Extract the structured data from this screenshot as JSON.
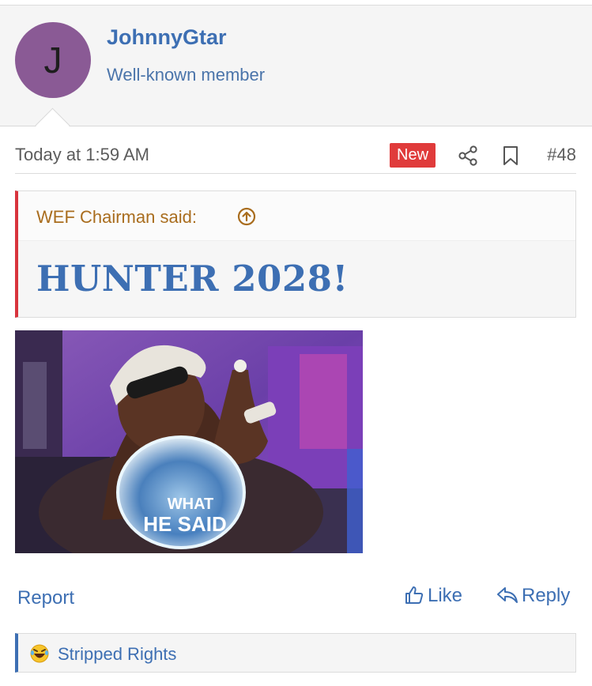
{
  "user": {
    "avatar_letter": "J",
    "name": "JohnnyGtar",
    "title": "Well-known member"
  },
  "post": {
    "timestamp": "Today at 1:59 AM",
    "new_label": "New",
    "number": "#48"
  },
  "quote": {
    "author": "WEF Chairman said:",
    "text": "HUNTER 2028!"
  },
  "gif": {
    "caption_line1": "WHAT",
    "caption_line2": "HE SAID"
  },
  "actions": {
    "report": "Report",
    "like": "Like",
    "reply": "Reply"
  },
  "reactions": {
    "icon": "laughing-emoji-icon",
    "users": "Stripped Rights"
  },
  "colors": {
    "link": "#3d6fb3",
    "quote_accent": "#d8343d",
    "badge": "#e03b3b",
    "avatar": "#8a5a95"
  }
}
